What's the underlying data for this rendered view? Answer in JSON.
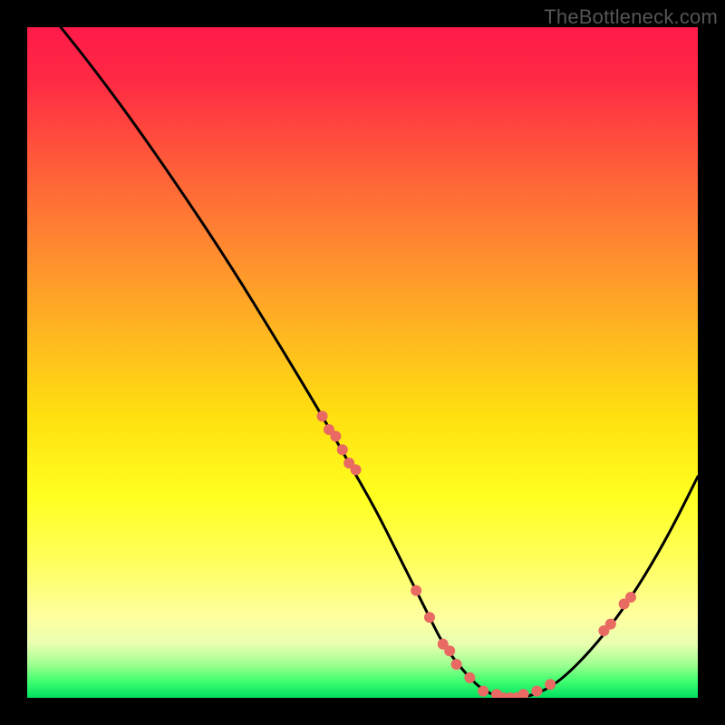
{
  "watermark": "TheBottleneck.com",
  "chart_data": {
    "type": "line",
    "title": "",
    "xlabel": "",
    "ylabel": "",
    "xlim": [
      0,
      100
    ],
    "ylim": [
      0,
      100
    ],
    "series": [
      {
        "name": "curve",
        "x": [
          5,
          9,
          15,
          22,
          30,
          38,
          44,
          48,
          52,
          55,
          58,
          60,
          62,
          65,
          68,
          71,
          74,
          77,
          80,
          84,
          88,
          92,
          96,
          100
        ],
        "y": [
          100,
          95,
          87,
          77,
          65,
          52,
          42,
          35,
          28,
          22,
          16,
          12,
          8,
          4,
          1,
          0,
          0,
          1,
          3,
          7,
          12,
          18,
          25,
          33
        ]
      }
    ],
    "dots_on_curve": {
      "name": "highlight-points",
      "color": "#e86a62",
      "x": [
        44,
        45,
        46,
        47,
        48,
        49,
        58,
        60,
        62,
        63,
        64,
        66,
        68,
        70,
        71,
        72,
        73,
        74,
        76,
        78,
        86,
        87,
        89,
        90
      ],
      "y": [
        42,
        40,
        39,
        37,
        35,
        34,
        16,
        12,
        8,
        7,
        5,
        3,
        1,
        0.5,
        0,
        0,
        0,
        0.5,
        1,
        2,
        10,
        11,
        14,
        15
      ]
    },
    "gradient_stops": [
      {
        "pos": 0,
        "color": "#ff1a4a"
      },
      {
        "pos": 20,
        "color": "#ff5a3a"
      },
      {
        "pos": 46,
        "color": "#ffb820"
      },
      {
        "pos": 70,
        "color": "#ffff20"
      },
      {
        "pos": 92,
        "color": "#e8ffb0"
      },
      {
        "pos": 100,
        "color": "#00e060"
      }
    ]
  }
}
